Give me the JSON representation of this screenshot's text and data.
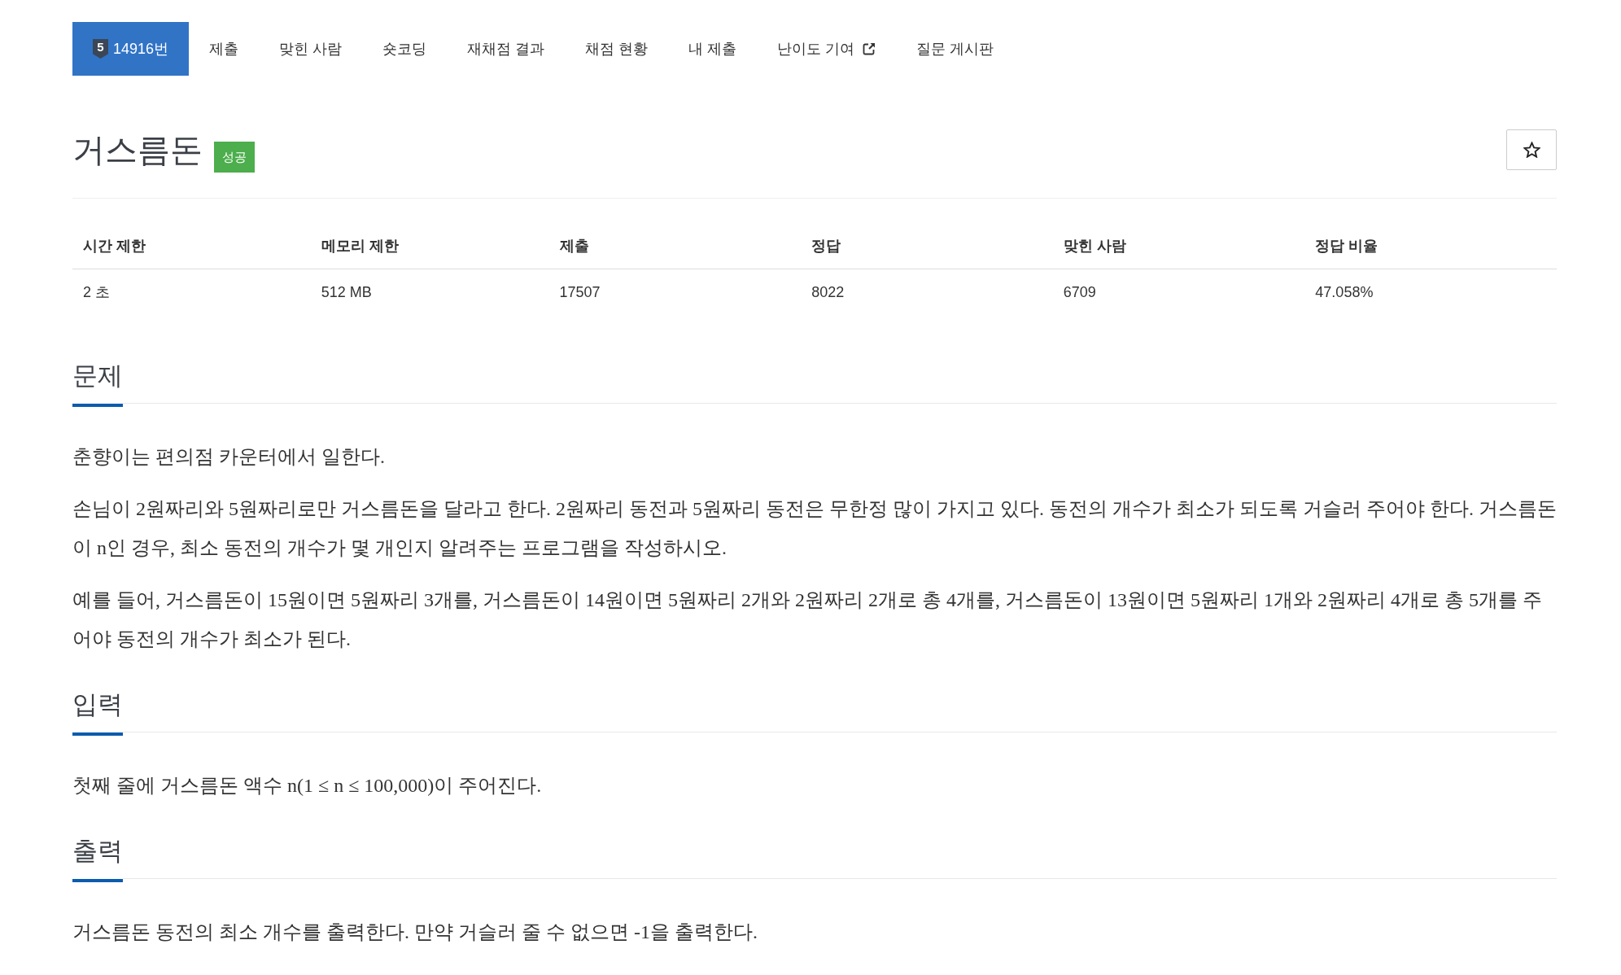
{
  "nav": {
    "tabs": [
      {
        "kind": "problem",
        "tier": "5",
        "label": "14916번",
        "selected": true
      },
      {
        "kind": "link",
        "label": "제출",
        "selected": false
      },
      {
        "kind": "link",
        "label": "맞힌 사람",
        "selected": false
      },
      {
        "kind": "link",
        "label": "숏코딩",
        "selected": false
      },
      {
        "kind": "link",
        "label": "재채점 결과",
        "selected": false
      },
      {
        "kind": "link",
        "label": "채점 현황",
        "selected": false
      },
      {
        "kind": "link",
        "label": "내 제출",
        "selected": false
      },
      {
        "kind": "external",
        "label": "난이도 기여",
        "selected": false
      },
      {
        "kind": "link",
        "label": "질문 게시판",
        "selected": false
      }
    ]
  },
  "problem": {
    "title": "거스름돈",
    "status_badge": "성공",
    "starred": false
  },
  "info_table": {
    "columns": [
      "시간 제한",
      "메모리 제한",
      "제출",
      "정답",
      "맞힌 사람",
      "정답 비율"
    ],
    "rows": [
      [
        "2 초",
        "512 MB",
        "17507",
        "8022",
        "6709",
        "47.058%"
      ]
    ]
  },
  "sections": [
    {
      "heading": "문제",
      "paragraphs": [
        "춘향이는 편의점 카운터에서 일한다.",
        "손님이 2원짜리와 5원짜리로만 거스름돈을 달라고 한다. 2원짜리 동전과 5원짜리 동전은 무한정 많이 가지고 있다. 동전의 개수가 최소가 되도록 거슬러 주어야 한다. 거스름돈이 n인 경우, 최소 동전의 개수가 몇 개인지 알려주는 프로그램을 작성하시오.",
        "예를 들어, 거스름돈이 15원이면 5원짜리 3개를, 거스름돈이 14원이면 5원짜리 2개와 2원짜리 2개로 총 4개를, 거스름돈이 13원이면 5원짜리 1개와 2원짜리 4개로 총 5개를 주어야 동전의 개수가 최소가 된다."
      ]
    },
    {
      "heading": "입력",
      "paragraphs": [
        "첫째 줄에 거스름돈 액수 n(1 ≤ n ≤ 100,000)이 주어진다."
      ]
    },
    {
      "heading": "출력",
      "paragraphs": [
        "거스름돈 동전의 최소 개수를 출력한다. 만약 거슬러 줄 수 없으면 -1을 출력한다."
      ]
    }
  ]
}
